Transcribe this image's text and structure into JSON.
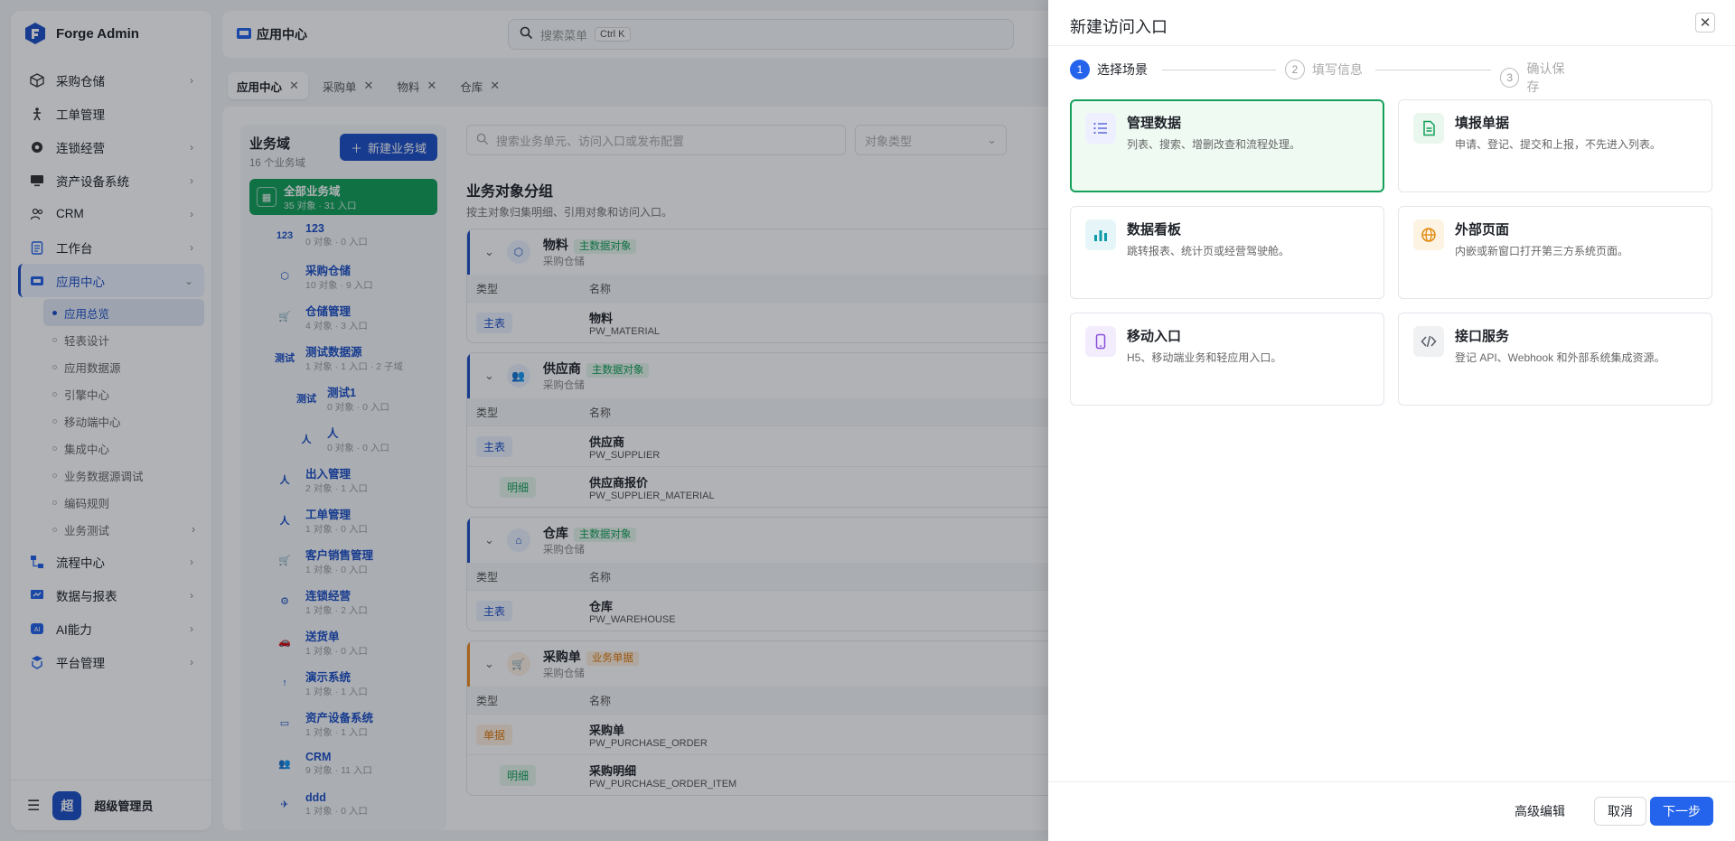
{
  "brand": {
    "name": "Forge Admin"
  },
  "sidebar": {
    "items": [
      {
        "label": "采购仓储",
        "icon": "box-icon",
        "chev": "›"
      },
      {
        "label": "工单管理",
        "icon": "person-icon",
        "chev": ""
      },
      {
        "label": "连锁经营",
        "icon": "gear-icon",
        "chev": "›"
      },
      {
        "label": "资产设备系统",
        "icon": "monitor-icon",
        "chev": "›"
      },
      {
        "label": "CRM",
        "icon": "users-icon",
        "chev": "›"
      },
      {
        "label": "工作台",
        "icon": "clipboard-icon",
        "chev": "›"
      }
    ],
    "active": {
      "label": "应用中心",
      "chev": "⌄"
    },
    "sub_items": [
      {
        "label": "应用总览"
      },
      {
        "label": "轻表设计"
      },
      {
        "label": "应用数据源"
      },
      {
        "label": "引擎中心"
      },
      {
        "label": "移动端中心"
      },
      {
        "label": "集成中心"
      },
      {
        "label": "业务数据源调试"
      },
      {
        "label": "编码规则"
      },
      {
        "label": "业务测试",
        "chev": "›"
      }
    ],
    "bottom_items": [
      {
        "label": "流程中心",
        "chev": "›"
      },
      {
        "label": "数据与报表",
        "chev": "›"
      },
      {
        "label": "AI能力",
        "chev": "›"
      },
      {
        "label": "平台管理",
        "chev": "›"
      }
    ],
    "user": {
      "avatar": "超",
      "name": "超级管理员"
    }
  },
  "topbar": {
    "title": "应用中心",
    "search_placeholder": "搜索菜单",
    "shortcut": "Ctrl K"
  },
  "tabs": [
    {
      "label": "应用中心"
    },
    {
      "label": "采购单"
    },
    {
      "label": "物料"
    },
    {
      "label": "仓库"
    }
  ],
  "domains": {
    "title": "业务域",
    "count": "16 个业务域",
    "new_button": "新建业务域",
    "all": {
      "name": "全部业务域",
      "meta": "35 对象 · 31 入口"
    },
    "items": [
      {
        "icon": "123",
        "name": "123",
        "meta": "0 对象 · 0 入口",
        "child": false
      },
      {
        "icon": "⬡",
        "name": "采购仓储",
        "meta": "10 对象 · 9 入口",
        "child": false
      },
      {
        "icon": "🛒",
        "name": "仓储管理",
        "meta": "4 对象 · 3 入口",
        "child": false
      },
      {
        "icon": "测试",
        "name": "测试数据源",
        "meta": "1 对象 · 1 入口 · 2 子域",
        "child": false
      },
      {
        "icon": "测试",
        "name": "测试1",
        "meta": "0 对象 · 0 入口",
        "child": true
      },
      {
        "icon": "人",
        "name": "人",
        "meta": "0 对象 · 0 入口",
        "child": true
      },
      {
        "icon": "人",
        "name": "出入管理",
        "meta": "2 对象 · 1 入口",
        "child": false
      },
      {
        "icon": "人",
        "name": "工单管理",
        "meta": "1 对象 · 0 入口",
        "child": false
      },
      {
        "icon": "🛒",
        "name": "客户销售管理",
        "meta": "1 对象 · 0 入口",
        "child": false
      },
      {
        "icon": "⚙",
        "name": "连锁经营",
        "meta": "1 对象 · 2 入口",
        "child": false
      },
      {
        "icon": "🚗",
        "name": "送货单",
        "meta": "1 对象 · 0 入口",
        "child": false
      },
      {
        "icon": "↑",
        "name": "演示系统",
        "meta": "1 对象 · 1 入口",
        "child": false
      },
      {
        "icon": "▭",
        "name": "资产设备系统",
        "meta": "1 对象 · 1 入口",
        "child": false
      },
      {
        "icon": "👥",
        "name": "CRM",
        "meta": "9 对象 · 11 入口",
        "child": false
      },
      {
        "icon": "✈",
        "name": "ddd",
        "meta": "1 对象 · 0 入口",
        "child": false
      }
    ]
  },
  "groups": {
    "search_placeholder": "搜索业务单元、访问入口或发布配置",
    "type_placeholder": "对象类型",
    "title": "业务对象分组",
    "subtitle": "按主对象归集明细、引用对象和访问入口。",
    "col_type": "类型",
    "col_name": "名称",
    "cards": [
      {
        "name": "物料",
        "domain": "采购仓储",
        "badge": "主数据对象",
        "rows": [
          {
            "tag": "主表",
            "name": "物料",
            "code": "PW_MATERIAL"
          }
        ]
      },
      {
        "name": "供应商",
        "domain": "采购仓储",
        "badge": "主数据对象",
        "rows": [
          {
            "tag": "主表",
            "name": "供应商",
            "code": "PW_SUPPLIER"
          },
          {
            "tag": "明细",
            "name": "供应商报价",
            "code": "PW_SUPPLIER_MATERIAL"
          }
        ]
      },
      {
        "name": "仓库",
        "domain": "采购仓储",
        "badge": "主数据对象",
        "rows": [
          {
            "tag": "主表",
            "name": "仓库",
            "code": "PW_WAREHOUSE"
          }
        ]
      },
      {
        "name": "采购单",
        "domain": "采购仓储",
        "badge": "业务单据",
        "rows": [
          {
            "tag": "单据",
            "name": "采购单",
            "code": "PW_PURCHASE_ORDER"
          },
          {
            "tag": "明细",
            "name": "采购明细",
            "code": "PW_PURCHASE_ORDER_ITEM"
          }
        ]
      }
    ]
  },
  "drawer": {
    "title": "新建访问入口",
    "steps": [
      {
        "num": "1",
        "label": "选择场景"
      },
      {
        "num": "2",
        "label": "填写信息"
      },
      {
        "num": "3",
        "label": "确认保存"
      }
    ],
    "scenarios": [
      {
        "title": "管理数据",
        "desc": "列表、搜索、增删改查和流程处理。",
        "icon": "list-icon",
        "color": "#5a6bd8",
        "bg": "#eef0ff"
      },
      {
        "title": "填报单据",
        "desc": "申请、登记、提交和上报，不先进入列表。",
        "icon": "document-icon",
        "color": "#14a05a",
        "bg": "#e9f7ef"
      },
      {
        "title": "数据看板",
        "desc": "跳转报表、统计页或经营驾驶舱。",
        "icon": "bar-chart-icon",
        "color": "#0f9aa8",
        "bg": "#e6f6f8"
      },
      {
        "title": "外部页面",
        "desc": "内嵌或新窗口打开第三方系统页面。",
        "icon": "globe-icon",
        "color": "#e08a0c",
        "bg": "#fdf3e3"
      },
      {
        "title": "移动入口",
        "desc": "H5、移动端业务和轻应用入口。",
        "icon": "mobile-icon",
        "color": "#8a4fd8",
        "bg": "#f3ecfd"
      },
      {
        "title": "接口服务",
        "desc": "登记 API、Webhook 和外部系统集成资源。",
        "icon": "code-icon",
        "color": "#555a66",
        "bg": "#f0f1f3"
      }
    ],
    "footer": {
      "advanced": "高级编辑",
      "cancel": "取消",
      "next": "下一步"
    }
  }
}
